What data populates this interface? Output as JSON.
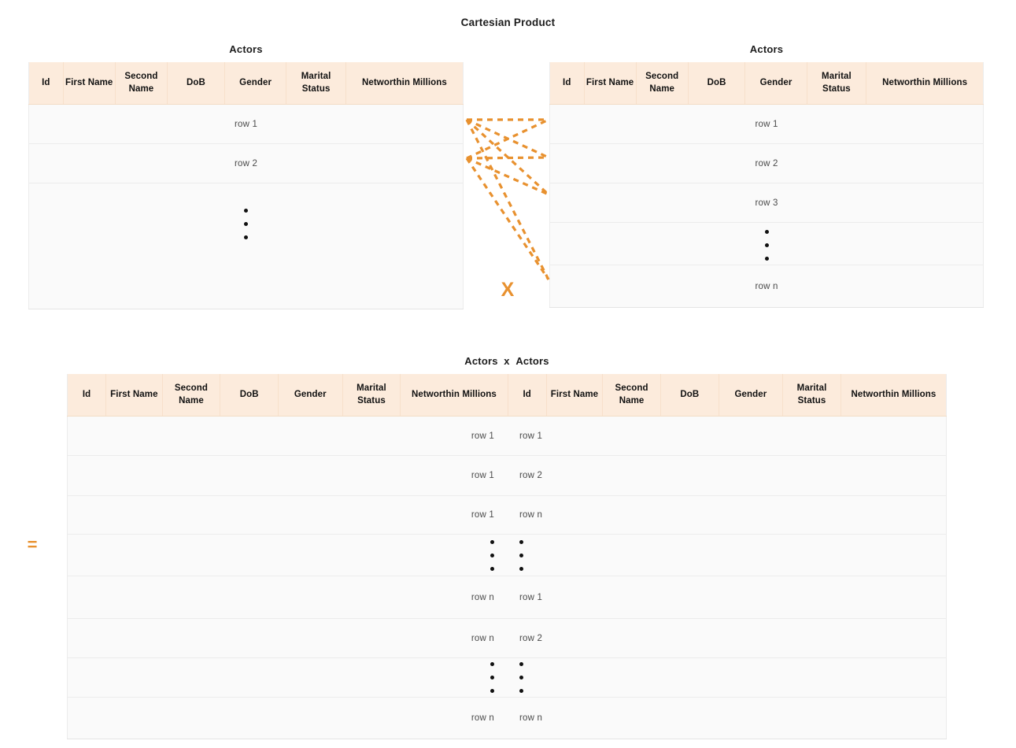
{
  "page": {
    "title": "Cartesian Product",
    "accent_color": "#e8912f",
    "header_bg": "#fcebdc",
    "row_bg": "#fafafa",
    "operator_times": "X",
    "operator_equals": "="
  },
  "columns": [
    "Id",
    "First Name",
    "Second Name",
    "DoB",
    "Gender",
    "Marital Status",
    "Networthin Millions"
  ],
  "left_table": {
    "title": "Actors",
    "columns": [
      "Id",
      "First Name",
      "Second Name",
      "DoB",
      "Gender",
      "Marital Status",
      "Networthin Millions"
    ],
    "rows": [
      {
        "type": "label",
        "text": "row 1"
      },
      {
        "type": "label",
        "text": "row 2"
      },
      {
        "type": "dots",
        "text": ""
      }
    ]
  },
  "right_table": {
    "title": "Actors",
    "columns": [
      "Id",
      "First Name",
      "Second Name",
      "DoB",
      "Gender",
      "Marital Status",
      "Networthin Millions"
    ],
    "rows": [
      {
        "type": "label",
        "text": "row 1"
      },
      {
        "type": "label",
        "text": "row 2"
      },
      {
        "type": "label",
        "text": "row 3"
      },
      {
        "type": "dots",
        "text": ""
      },
      {
        "type": "label",
        "text": "row n"
      }
    ]
  },
  "result_table": {
    "title": "Actors  x  Actors",
    "title_left": "Actors",
    "title_operator": "x",
    "title_right": "Actors",
    "columns": [
      "Id",
      "First Name",
      "Second Name",
      "DoB",
      "Gender",
      "Marital Status",
      "Networthin Millions",
      "Id",
      "First Name",
      "Second Name",
      "DoB",
      "Gender",
      "Marital Status",
      "Networthin Millions"
    ],
    "rows": [
      {
        "type": "pair",
        "left": "row 1",
        "right": "row 1"
      },
      {
        "type": "pair",
        "left": "row 1",
        "right": "row 2"
      },
      {
        "type": "pair",
        "left": "row 1",
        "right": "row n"
      },
      {
        "type": "dots",
        "left": "",
        "right": ""
      },
      {
        "type": "pair",
        "left": "row n",
        "right": "row 1"
      },
      {
        "type": "pair",
        "left": "row n",
        "right": "row 2"
      },
      {
        "type": "dots",
        "left": "",
        "right": ""
      },
      {
        "type": "pair",
        "left": "row n",
        "right": "row n"
      }
    ]
  }
}
